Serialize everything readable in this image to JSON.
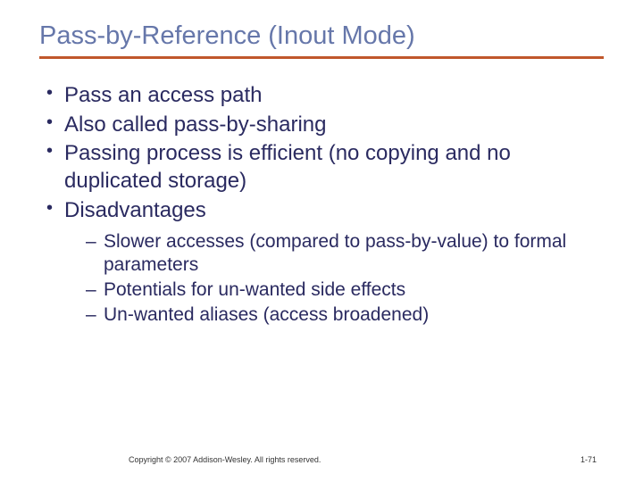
{
  "title": "Pass-by-Reference (Inout Mode)",
  "bullets": {
    "b0": "Pass an access path",
    "b1": "Also called pass-by-sharing",
    "b2": "Passing process is efficient (no copying and no duplicated storage)",
    "b3": "Disadvantages"
  },
  "sub": {
    "s0": "Slower accesses (compared to pass-by-value) to formal parameters",
    "s1": "Potentials for un-wanted side effects",
    "s2": "Un-wanted aliases (access broadened)"
  },
  "footer": {
    "copyright": "Copyright © 2007 Addison-Wesley. All rights reserved.",
    "page": "1-71"
  }
}
